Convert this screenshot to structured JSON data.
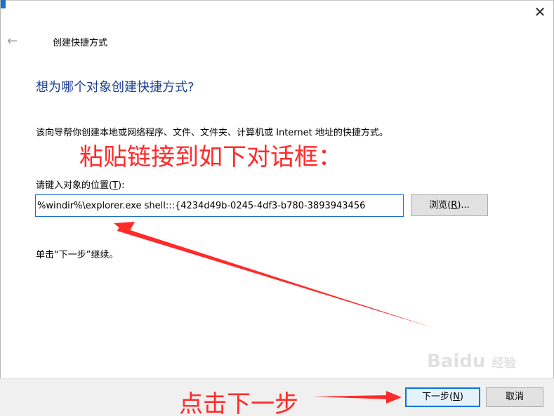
{
  "window": {
    "close_glyph": "✕"
  },
  "nav": {
    "back_icon": "left-arrow-icon",
    "back_glyph": "←"
  },
  "wizard": {
    "title": "创建快捷方式",
    "heading": "想为哪个对象创建快捷方式?",
    "description": "该向导帮你创建本地或网络程序、文件、文件夹、计算机或 Internet 地址的快捷方式。",
    "location_label_prefix": "请键入对象的位置(",
    "location_label_key": "T",
    "location_label_suffix": "):",
    "location_value": "%windir%\\explorer.exe shell:::{4234d49b-0245-4df3-b780-3893943456",
    "browse_prefix": "浏览(",
    "browse_key": "R",
    "browse_suffix": ")...",
    "hint": "单击“下一步”继续。"
  },
  "footer": {
    "next_prefix": "下一步(",
    "next_key": "N",
    "next_suffix": ")",
    "cancel": "取消"
  },
  "annotations": {
    "top_text": "粘贴链接到如下对话框：",
    "bottom_text": "点击下一步",
    "color": "#ff2a2a"
  },
  "watermark": {
    "brand": "Bai",
    "paw": "du",
    "suffix": "经验"
  }
}
